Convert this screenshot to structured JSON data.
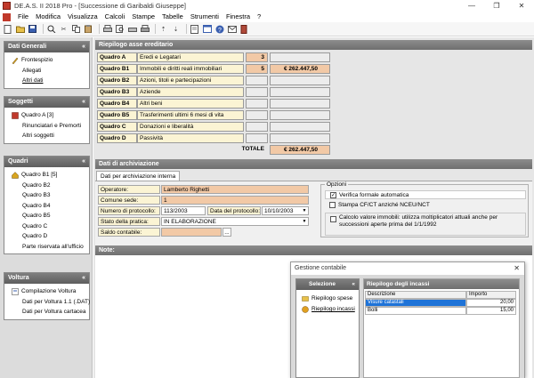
{
  "window": {
    "title": "DE.A.S. II 2018 Pro - [Successione di Garibaldi Giuseppe]",
    "controls": [
      "—",
      "❐",
      "✕"
    ]
  },
  "menu": [
    "File",
    "Modifica",
    "Visualizza",
    "Calcoli",
    "Stampe",
    "Tabelle",
    "Strumenti",
    "Finestra",
    "?"
  ],
  "sidebar": {
    "dati_generali": {
      "title": "Dati Generali",
      "items": [
        "Frontespizio",
        "Allegati",
        "Altri dati"
      ]
    },
    "soggetti": {
      "title": "Soggetti",
      "items": [
        "Quadro A [3]",
        "Rinunciatari e Premorti",
        "Altri soggetti"
      ]
    },
    "quadri": {
      "title": "Quadri",
      "items": [
        "Quadro B1 [5]",
        "Quadro B2",
        "Quadro B3",
        "Quadro B4",
        "Quadro B5",
        "Quadro C",
        "Quadro D",
        "Parte riservata all'ufficio"
      ]
    },
    "voltura": {
      "title": "Voltura",
      "items": [
        "Compilazione Voltura",
        "Dati per Voltura 1.1 (.DAT)",
        "Dati per Voltura cartacea"
      ]
    }
  },
  "riepilogo": {
    "title": "Riepilogo asse ereditario",
    "rows": [
      {
        "code": "Quadro A",
        "desc": "Eredi e Legatari",
        "num": "3",
        "value": ""
      },
      {
        "code": "Quadro B1",
        "desc": "Immobili e diritti reali immobiliari",
        "num": "5",
        "value": "€ 262.447,50"
      },
      {
        "code": "Quadro B2",
        "desc": "Azioni, titoli e partecipazioni",
        "num": "",
        "value": ""
      },
      {
        "code": "Quadro B3",
        "desc": "Aziende",
        "num": "",
        "value": ""
      },
      {
        "code": "Quadro B4",
        "desc": "Altri beni",
        "num": "",
        "value": ""
      },
      {
        "code": "Quadro B5",
        "desc": "Trasferimenti ultimi 6 mesi di vita",
        "num": "",
        "value": ""
      },
      {
        "code": "Quadro C",
        "desc": "Donazioni e liberalità",
        "num": "",
        "value": ""
      },
      {
        "code": "Quadro D",
        "desc": "Passività",
        "num": "",
        "value": ""
      }
    ],
    "totale_label": "TOTALE",
    "totale_value": "€ 262.447,50"
  },
  "archiviazione": {
    "title": "Dati di archiviazione",
    "tab": "Dati per archiviazione interna",
    "operatore_label": "Operatore:",
    "operatore": "Lamberto Righetti",
    "comune_label": "Comune sede:",
    "comune": "1",
    "protocollo_label": "Numero di protocollo:",
    "protocollo": "113/2003",
    "data_label": "Data del protocollo:",
    "data": "10/10/2003",
    "stato_label": "Stato della pratica:",
    "stato": "IN ELABORAZIONE",
    "saldo_label": "Saldo contabile:",
    "saldo_btn": "...",
    "opzioni": {
      "title": "Opzioni",
      "opt1": "Verifica formale automatica",
      "opt1_checked": "✓",
      "opt2": "Stampa CF/CT anziché NCEU/NCT",
      "opt3": "Calcolo valore immobili: utilizza moltiplicatori attuali anche per successioni aperte prima del 1/1/1992"
    }
  },
  "note": {
    "title": "Note:"
  },
  "dialog": {
    "title": "Gestione contabile",
    "close": "✕",
    "selezione_title": "Selezione",
    "selezione_items": [
      "Riepilogo spese",
      "Riepilogo incassi"
    ],
    "incassi_title": "Riepilogo degli incassi",
    "col_descrizione": "Descrizione",
    "col_importo": "Importo",
    "rows": [
      {
        "desc": "Visure catastali",
        "importo": "20,00"
      },
      {
        "desc": "Bolli",
        "importo": "15,00"
      }
    ]
  }
}
